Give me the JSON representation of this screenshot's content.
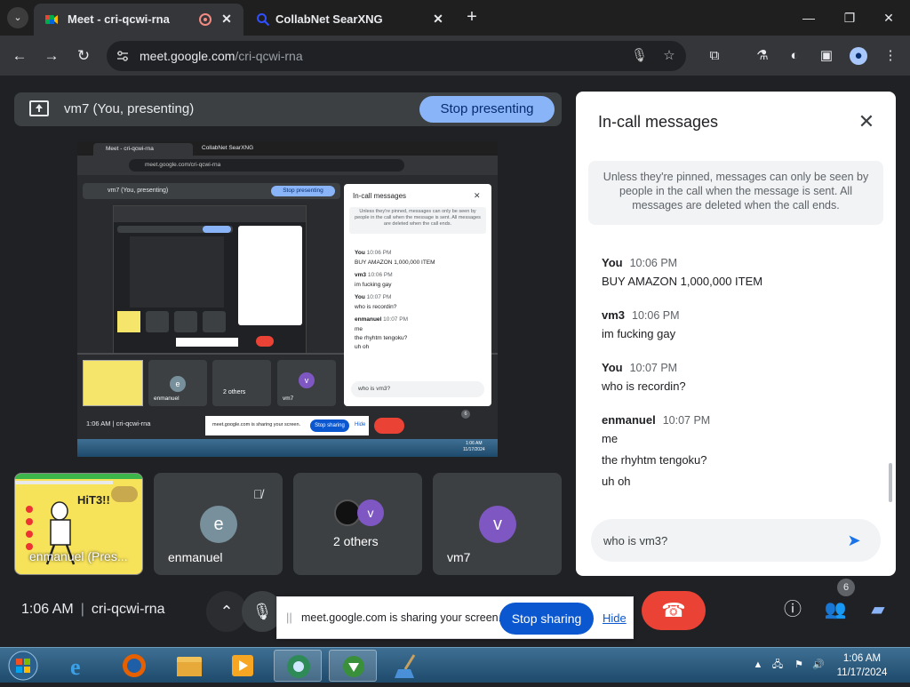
{
  "browser": {
    "tabs": [
      {
        "title": "Meet - cri-qcwi-rna",
        "active": true,
        "recording": true
      },
      {
        "title": "CollabNet SearXNG",
        "active": false
      }
    ],
    "new_tab": "+",
    "window_controls": {
      "minimize": "—",
      "maximize": "❐",
      "close": "✕"
    },
    "url_host": "meet.google.com",
    "url_path": "/cri-qcwi-rna"
  },
  "meet": {
    "presenting_label": "vm7 (You, presenting)",
    "stop_presenting": "Stop presenting",
    "tiles": [
      {
        "name": "enmanuel (Pres...",
        "type": "screen"
      },
      {
        "name": "enmanuel",
        "avatar_letter": "e",
        "avatar_color": "#78909c",
        "muted": true
      },
      {
        "name": "2 others",
        "avatar_letter": "v",
        "avatar_color": "#7e57c2"
      },
      {
        "name": "vm7",
        "avatar_letter": "v",
        "avatar_color": "#7e57c2"
      }
    ],
    "shared_screen_tile_text": "HiT3!!",
    "clock": "1:06 AM",
    "meeting_code": "cri-qcwi-rna",
    "people_count": "6"
  },
  "chat": {
    "title": "In-call messages",
    "notice": "Unless they're pinned, messages can only be seen by people in the call when the message is sent. All messages are deleted when the call ends.",
    "messages": [
      {
        "sender": "You",
        "time": "10:06 PM",
        "lines": [
          "BUY AMAZON 1,000,000 ITEM"
        ]
      },
      {
        "sender": "vm3",
        "time": "10:06 PM",
        "lines": [
          "im fucking gay"
        ]
      },
      {
        "sender": "You",
        "time": "10:07 PM",
        "lines": [
          "who is recordin?"
        ]
      },
      {
        "sender": "enmanuel",
        "time": "10:07 PM",
        "lines": [
          "me",
          "the rhyhtm tengoku?",
          "uh oh"
        ]
      }
    ],
    "input_value": "who is vm3?"
  },
  "share_bar": {
    "grip": "||",
    "message": "meet.google.com is sharing your screen.",
    "stop_sharing": "Stop sharing",
    "hide": "Hide"
  },
  "preview": {
    "tab1": "Meet - cri-qcwi-rna",
    "tab2": "CollabNet SearXNG",
    "url": "meet.google.com/cri-qcwi-rna",
    "presenting": "vm7 (You, presenting)",
    "stop_presenting": "Stop presenting",
    "chat_title": "In-call messages",
    "notice": "Unless they're pinned, messages can only be seen by people in the call when the message is sent. All messages are deleted when the call ends.",
    "msgs": [
      {
        "s": "You",
        "t": "10:06 PM",
        "m": "BUY AMAZON 1,000,000 ITEM"
      },
      {
        "s": "vm3",
        "t": "10:06 PM",
        "m": "im fucking gay"
      },
      {
        "s": "You",
        "t": "10:07 PM",
        "m": "who is recordin?"
      },
      {
        "s": "enmanuel",
        "t": "10:07 PM",
        "m": "me"
      }
    ],
    "msg_extra": [
      "the rhyhtm tengoku?",
      "uh oh"
    ],
    "input": "who is vm3?",
    "tile_enmanuel": "enmanuel",
    "tile_others": "2 others",
    "tile_vm7": "vm7",
    "clock": "1:06 AM",
    "code": "cri-qcwi-rna",
    "share_msg": "meet.google.com is sharing your screen.",
    "stop_sharing": "Stop sharing",
    "hide": "Hide",
    "people_count": "6",
    "tray_time": "1:06 AM",
    "tray_date": "11/17/2024"
  },
  "taskbar": {
    "time": "1:06 AM",
    "date": "11/17/2024",
    "apps": [
      "internet-explorer",
      "firefox",
      "file-explorer",
      "media-player",
      "chrome",
      "download-manager",
      "cleaner"
    ]
  }
}
